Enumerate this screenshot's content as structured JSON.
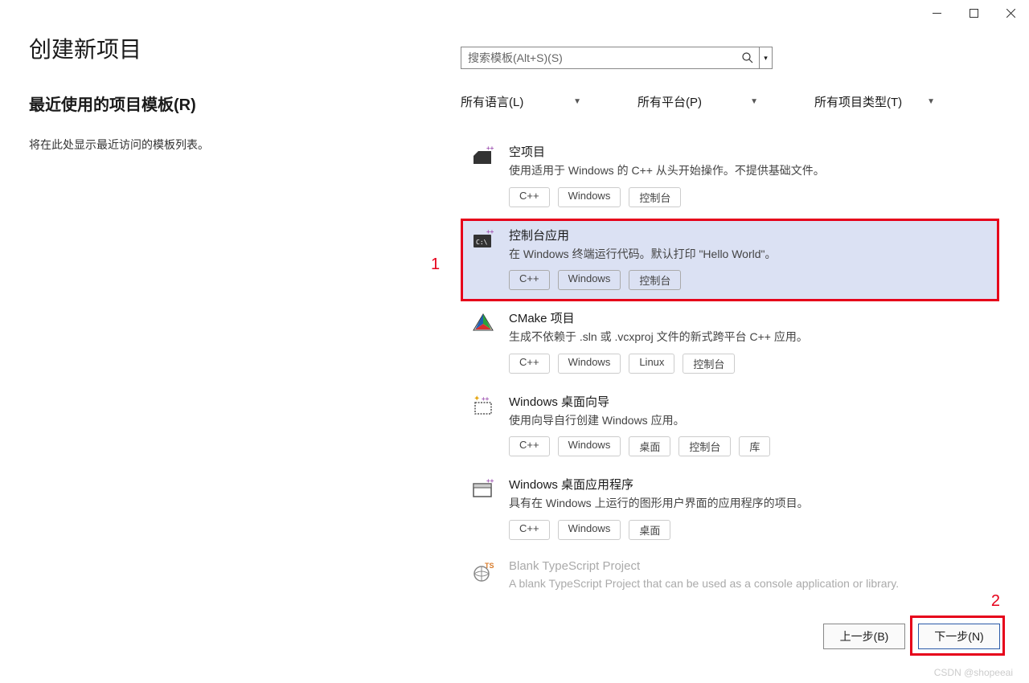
{
  "window": {
    "title": "创建新项目"
  },
  "search": {
    "placeholder": "搜索模板(Alt+S)(S)"
  },
  "recent": {
    "title": "最近使用的项目模板(R)",
    "empty_text": "将在此处显示最近访问的模板列表。"
  },
  "filters": {
    "language": "所有语言(L)",
    "platform": "所有平台(P)",
    "projtype": "所有项目类型(T)"
  },
  "templates": [
    {
      "title": "空项目",
      "desc": "使用适用于 Windows 的 C++ 从头开始操作。不提供基础文件。",
      "tags": [
        "C++",
        "Windows",
        "控制台"
      ],
      "icon": "empty-proj"
    },
    {
      "title": "控制台应用",
      "desc": "在 Windows 终端运行代码。默认打印 \"Hello World\"。",
      "tags": [
        "C++",
        "Windows",
        "控制台"
      ],
      "icon": "console",
      "selected": true
    },
    {
      "title": "CMake 项目",
      "desc": "生成不依赖于 .sln 或 .vcxproj 文件的新式跨平台 C++ 应用。",
      "tags": [
        "C++",
        "Windows",
        "Linux",
        "控制台"
      ],
      "icon": "cmake"
    },
    {
      "title": "Windows 桌面向导",
      "desc": "使用向导自行创建 Windows 应用。",
      "tags": [
        "C++",
        "Windows",
        "桌面",
        "控制台",
        "库"
      ],
      "icon": "wizard"
    },
    {
      "title": "Windows 桌面应用程序",
      "desc": "具有在 Windows 上运行的图形用户界面的应用程序的项目。",
      "tags": [
        "C++",
        "Windows",
        "桌面"
      ],
      "icon": "desktop-app"
    },
    {
      "title": "Blank TypeScript Project",
      "desc": "A blank TypeScript Project that can be used as a console application or library.",
      "tags": [],
      "icon": "ts",
      "dimmed": true
    }
  ],
  "annotations": {
    "marker1": "1",
    "marker2": "2"
  },
  "buttons": {
    "back": "上一步(B)",
    "next": "下一步(N)"
  },
  "watermark": "CSDN @shopeeai"
}
